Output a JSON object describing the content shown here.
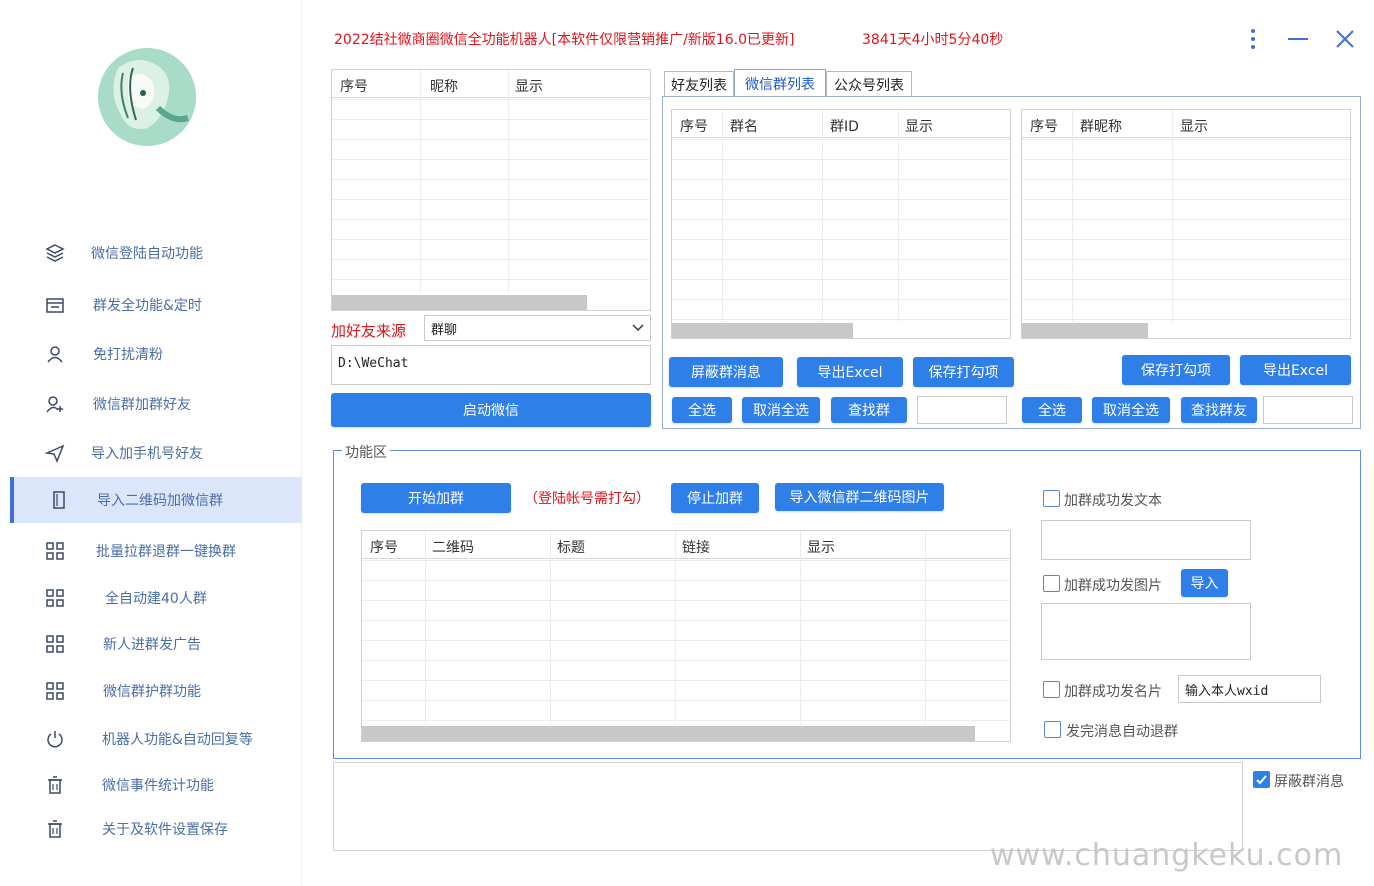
{
  "window": {
    "title": "2022结社微商圈微信全功能机器人[本软件仅限营销推广/新版16.0已更新]",
    "timer": "3841天4小时5分40秒"
  },
  "sidebar": {
    "items": [
      {
        "label": "微信登陆自动功能",
        "icon": "layers-icon"
      },
      {
        "label": "群发全功能&定时",
        "icon": "folder-icon"
      },
      {
        "label": "免打扰清粉",
        "icon": "user-icon"
      },
      {
        "label": "微信群加群好友",
        "icon": "user-add-icon"
      },
      {
        "label": "导入加手机号好友",
        "icon": "send-icon"
      },
      {
        "label": "导入二维码加微信群",
        "icon": "phone-icon"
      },
      {
        "label": "批量拉群退群一键换群",
        "icon": "grid-icon"
      },
      {
        "label": "全自动建40人群",
        "icon": "grid-icon"
      },
      {
        "label": "新人进群发广告",
        "icon": "grid-icon"
      },
      {
        "label": "微信群护群功能",
        "icon": "grid-icon"
      },
      {
        "label": "机器人功能&自动回复等",
        "icon": "power-icon"
      },
      {
        "label": "微信事件统计功能",
        "icon": "trash-icon"
      },
      {
        "label": "关于及软件设置保存",
        "icon": "trash-icon"
      }
    ],
    "active_index": 5
  },
  "left_table": {
    "columns": [
      "序号",
      "昵称",
      "显示"
    ]
  },
  "friend_source": {
    "label": "加好友来源",
    "selected": "群聊"
  },
  "path_field": {
    "value": "D:\\WeChat"
  },
  "start_wechat_button": "启动微信",
  "tabs": [
    "好友列表",
    "微信群列表",
    "公众号列表"
  ],
  "active_tab": 1,
  "group_table": {
    "columns": [
      "序号",
      "群名",
      "群ID",
      "显示"
    ]
  },
  "member_table": {
    "columns": [
      "序号",
      "群昵称",
      "显示"
    ]
  },
  "group_buttons": {
    "block": "屏蔽群消息",
    "export": "导出Excel",
    "save": "保存打勾项",
    "select_all": "全选",
    "deselect_all": "取消全选",
    "find": "查找群"
  },
  "member_buttons": {
    "save": "保存打勾项",
    "export": "导出Excel",
    "select_all": "全选",
    "deselect_all": "取消全选",
    "find": "查找群友"
  },
  "function_area": {
    "title": "功能区",
    "start_button": "开始加群",
    "hint": "（登陆帐号需打勾）",
    "stop_button": "停止加群",
    "import_qr_button": "导入微信群二维码图片",
    "qr_table_columns": [
      "序号",
      "二维码",
      "标题",
      "链接",
      "显示"
    ],
    "options": {
      "send_text": "加群成功发文本",
      "send_image": "加群成功发图片",
      "import_button": "导入",
      "send_card": "加群成功发名片",
      "wxid_placeholder": "输入本人wxid",
      "auto_quit": "发完消息自动退群"
    }
  },
  "bottom": {
    "block_group_msg": "屏蔽群消息",
    "block_checked": true
  },
  "watermark": "www.chuangkeku.com",
  "colors": {
    "accent": "#2f7fe8",
    "title_red": "#e0141b",
    "sidebar_active": "#dbe6fb"
  }
}
